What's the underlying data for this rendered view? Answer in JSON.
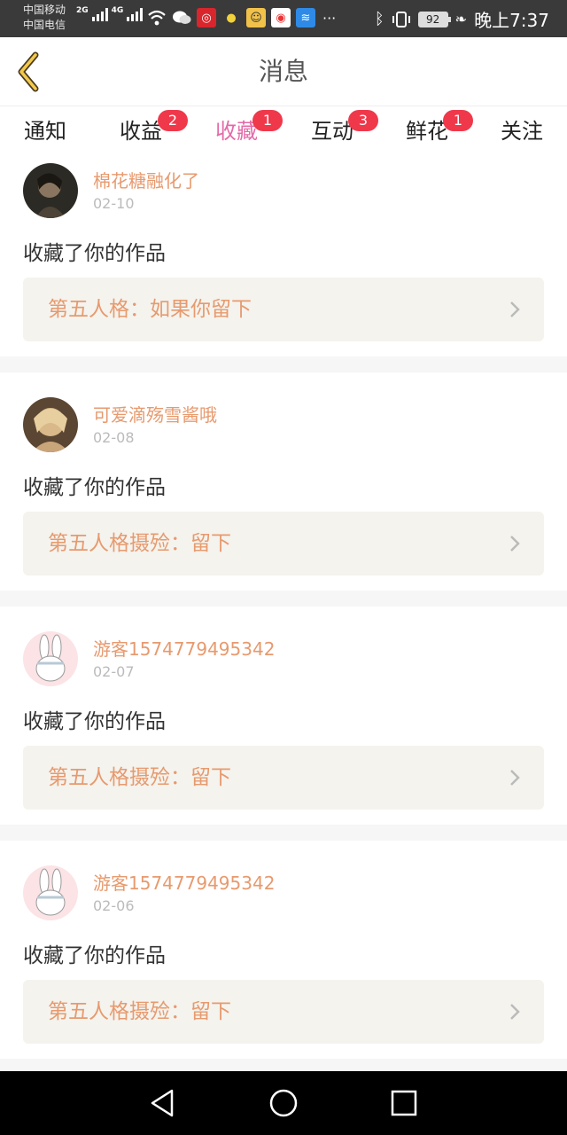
{
  "status_bar": {
    "carrier_1": "中国移动",
    "carrier_2": "中国电信",
    "net_1": "2G",
    "net_2": "4G",
    "battery": "92",
    "time": "晚上7:37",
    "app_icons": [
      "netease-music-icon",
      "bulb-icon",
      "game-icon",
      "weibo-icon",
      "wifi-app-icon"
    ],
    "overflow": "···"
  },
  "header": {
    "title": "消息",
    "back_icon": "chevron-left-icon"
  },
  "tabs": [
    {
      "label": "通知",
      "badge": "",
      "active": false
    },
    {
      "label": "收益",
      "badge": "2",
      "active": false
    },
    {
      "label": "收藏",
      "badge": "1",
      "active": true
    },
    {
      "label": "互动",
      "badge": "3",
      "active": false
    },
    {
      "label": "鲜花",
      "badge": "1",
      "active": false
    },
    {
      "label": "关注",
      "badge": "",
      "active": false
    }
  ],
  "colors": {
    "accent": "#e46aa8",
    "badge": "#f0384b",
    "username": "#e79a6e",
    "work_bg": "#f4f3ee"
  },
  "messages": [
    {
      "username": "棉花糖融化了",
      "date": "02-10",
      "action": "收藏了你的作品",
      "work_title": "第五人格：如果你留下",
      "avatar": "dark-portrait-avatar"
    },
    {
      "username": "可爱滴殇雪酱哦",
      "date": "02-08",
      "action": "收藏了你的作品",
      "work_title": "第五人格摄殓：留下",
      "avatar": "anime-girl-avatar"
    },
    {
      "username": "游客1574779495342",
      "date": "02-07",
      "action": "收藏了你的作品",
      "work_title": "第五人格摄殓：留下",
      "avatar": "bunny-avatar"
    },
    {
      "username": "游客1574779495342",
      "date": "02-06",
      "action": "收藏了你的作品",
      "work_title": "第五人格摄殓：留下",
      "avatar": "bunny-avatar"
    }
  ],
  "nav_bar": {
    "back": "back-triangle-icon",
    "home": "home-circle-icon",
    "recents": "recents-square-icon"
  }
}
